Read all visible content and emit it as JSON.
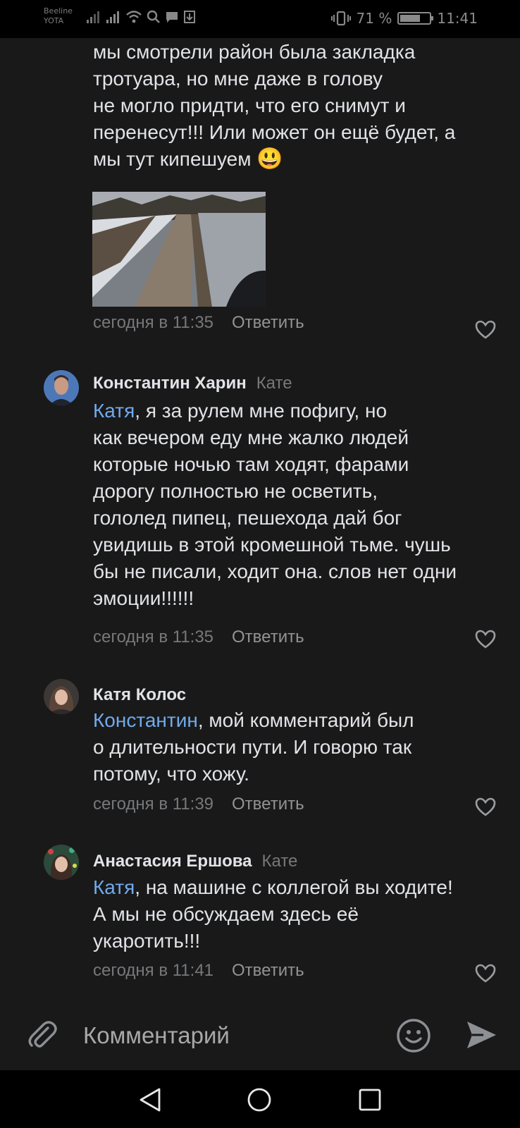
{
  "status_bar": {
    "carrier_1": "Beeline",
    "carrier_2": "YOTA",
    "battery_percent_text": "71 %",
    "battery_level": 0.71,
    "time": "11:41"
  },
  "top_comment": {
    "text_lines": [
      "мы смотрели район была закладка",
      "тротуара, но мне даже в голову",
      "не могло придти, что его снимут и",
      "перенесут!!! Или может он ещё будет, а",
      "мы тут кипешуем"
    ],
    "emoji": "😃",
    "time": "сегодня в 11:35",
    "reply_label": "Ответить"
  },
  "comments": [
    {
      "author": "Константин Харин",
      "reply_to": "Кате",
      "mention": "Катя",
      "text_first": ", я за рулем мне пофигу, но",
      "text_rest": [
        "как вечером еду мне жалко людей",
        "которые ночью там ходят, фарами",
        "дорогу полностью не осветить,",
        "гололед пипец, пешехода дай бог",
        "увидишь в этой кромешной тьме. чушь",
        "бы не писали, ходит она. слов нет одни",
        "эмоции!!!!!!"
      ],
      "time": "сегодня в 11:35",
      "reply_label": "Ответить"
    },
    {
      "author": "Катя Колос",
      "reply_to": "",
      "mention": "Константин",
      "text_first": ", мой комментарий был",
      "text_rest": [
        "о длительности пути. И говорю так",
        "потому, что хожу."
      ],
      "time": "сегодня в 11:39",
      "reply_label": "Ответить"
    },
    {
      "author": "Анастасия Ершова",
      "reply_to": "Кате",
      "mention": "Катя",
      "text_first": ", на машине с коллегой вы ходите!",
      "text_rest": [
        "А мы не обсуждаем здесь её",
        "укаротить!!!"
      ],
      "time": "сегодня в 11:41",
      "reply_label": "Ответить"
    }
  ],
  "composer": {
    "placeholder": "Комментарий"
  },
  "icons": {
    "attach": "paperclip-icon",
    "emoji": "smiley-icon",
    "send": "send-icon",
    "like": "heart-icon",
    "nav_back": "back-triangle-icon",
    "nav_home": "home-circle-icon",
    "nav_recents": "recents-square-icon"
  },
  "colors": {
    "background": "#19191a",
    "text": "#e1e3e6",
    "secondary": "#76787a",
    "mention": "#71aaeb"
  }
}
